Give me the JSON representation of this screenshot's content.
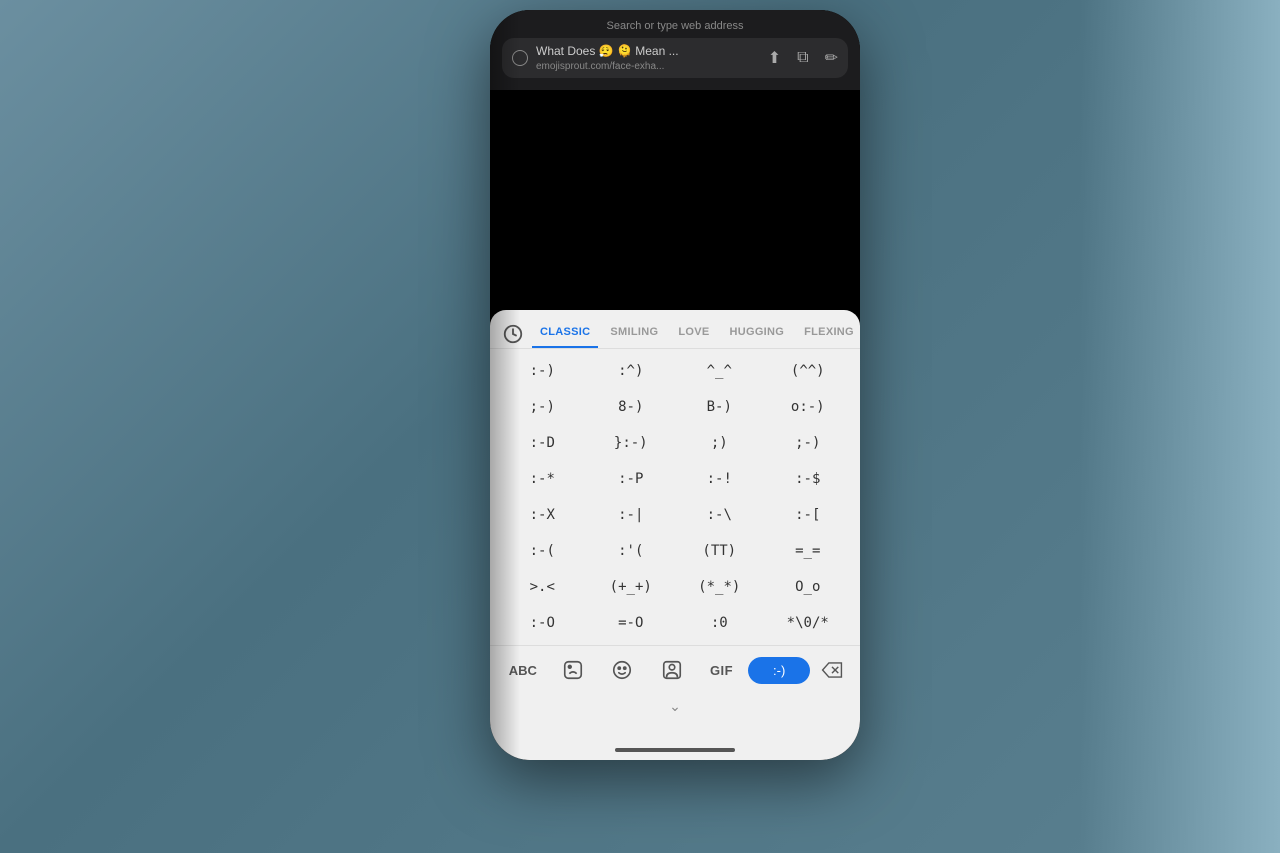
{
  "background": {
    "color": "#5a7a8a"
  },
  "phone": {
    "browser": {
      "search_hint": "Search or type web address",
      "page_title": "What Does 😮‍💨 🫠 Mean ...",
      "url": "emojisprout.com/face-exha...",
      "icons": [
        "share",
        "copy",
        "edit"
      ]
    },
    "keyboard": {
      "tabs": [
        {
          "id": "classic",
          "label": "CLASSIC",
          "active": true
        },
        {
          "id": "smiling",
          "label": "SMILING",
          "active": false
        },
        {
          "id": "love",
          "label": "LOVE",
          "active": false
        },
        {
          "id": "hugging",
          "label": "HUGGING",
          "active": false
        },
        {
          "id": "flexing",
          "label": "FLEXING",
          "active": false
        }
      ],
      "emoticons": [
        [
          ":-)",
          ":^)",
          "^_^",
          "(^^)"
        ],
        [
          ";-)",
          "8-)",
          "B-)",
          "o:-)"
        ],
        [
          ":-D",
          "}:-)",
          ";)",
          ";-)"
        ],
        [
          ":-*",
          ":-P",
          ":-!",
          ":-$"
        ],
        [
          ":-X",
          ":-|",
          ":-\\",
          ":-["
        ],
        [
          ":-(",
          ":'(",
          "(TT)",
          "=_="
        ],
        [
          ">.<",
          "(+_+)",
          "(*_*)",
          "O_o"
        ],
        [
          ":-O",
          "=-O",
          ":0",
          "*\\0/*"
        ]
      ],
      "toolbar": {
        "abc_label": "ABC",
        "gif_label": "GIF",
        "smiley_label": ":-)"
      }
    }
  }
}
